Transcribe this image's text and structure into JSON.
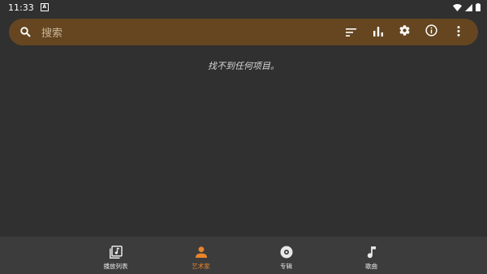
{
  "status_bar": {
    "time": "11:33",
    "app_indicator": "A",
    "icons": [
      "wifi-icon",
      "signal-icon",
      "battery-icon"
    ]
  },
  "search": {
    "placeholder": "搜索",
    "icons": [
      "search-icon",
      "sort-icon",
      "equalizer-icon",
      "settings-icon",
      "info-icon",
      "more-vert-icon"
    ]
  },
  "main": {
    "empty_message": "找不到任何项目。"
  },
  "bottom_nav": {
    "items": [
      {
        "label": "播放列表",
        "icon": "playlist-icon",
        "active": false
      },
      {
        "label": "艺术家",
        "icon": "artist-icon",
        "active": true
      },
      {
        "label": "专辑",
        "icon": "album-icon",
        "active": false
      },
      {
        "label": "歌曲",
        "icon": "song-icon",
        "active": false
      }
    ]
  },
  "colors": {
    "background": "#303030",
    "search_bar": "#654620",
    "bottom_nav": "#3c3c3c",
    "accent": "#e8852a"
  }
}
